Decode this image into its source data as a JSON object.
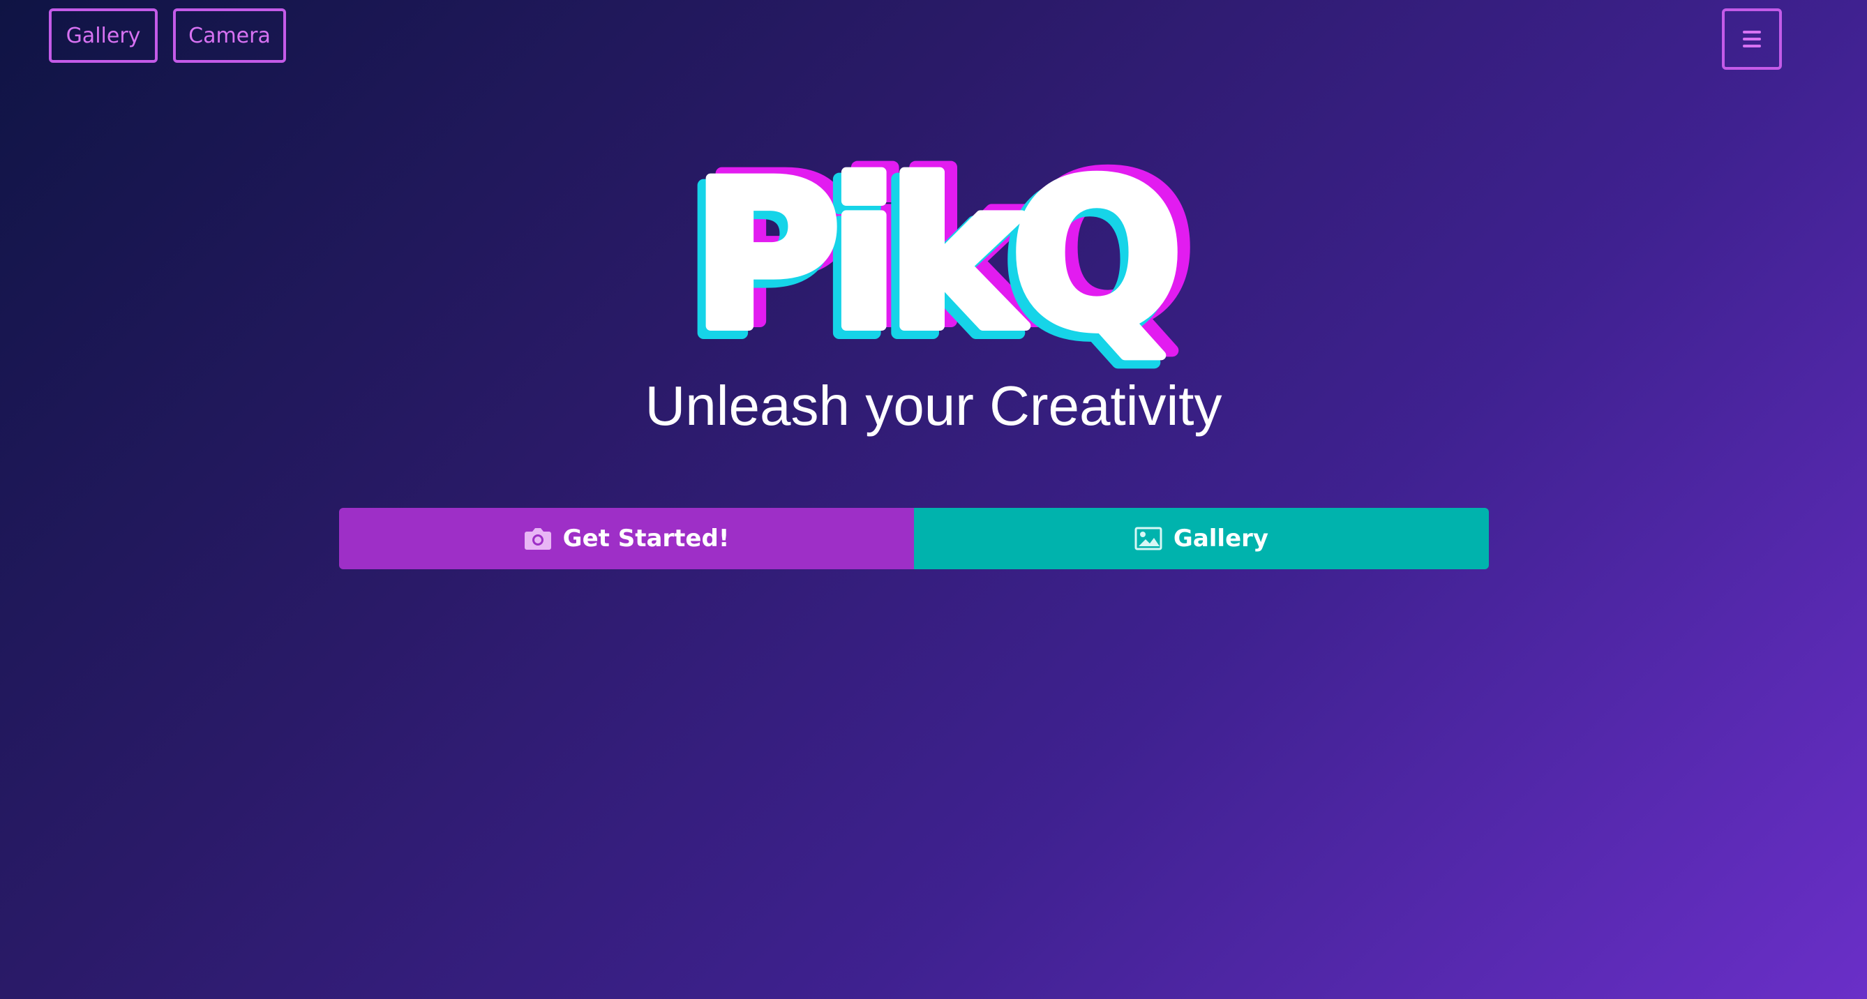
{
  "header": {
    "gallery_label": "Gallery",
    "camera_label": "Camera",
    "menu_icon": "hamburger-menu-icon"
  },
  "hero": {
    "logo_text": "PikQ",
    "tagline": "Unleash your Creativity"
  },
  "actions": {
    "get_started_label": "Get Started!",
    "get_started_icon": "camera-icon",
    "gallery_label": "Gallery",
    "gallery_icon": "image-icon"
  },
  "colors": {
    "accent_outline": "#c45be8",
    "primary_button": "#9e2fc7",
    "secondary_button": "#00b3ad",
    "logo_magenta": "#e21cf0",
    "logo_cyan": "#16d4e8"
  }
}
